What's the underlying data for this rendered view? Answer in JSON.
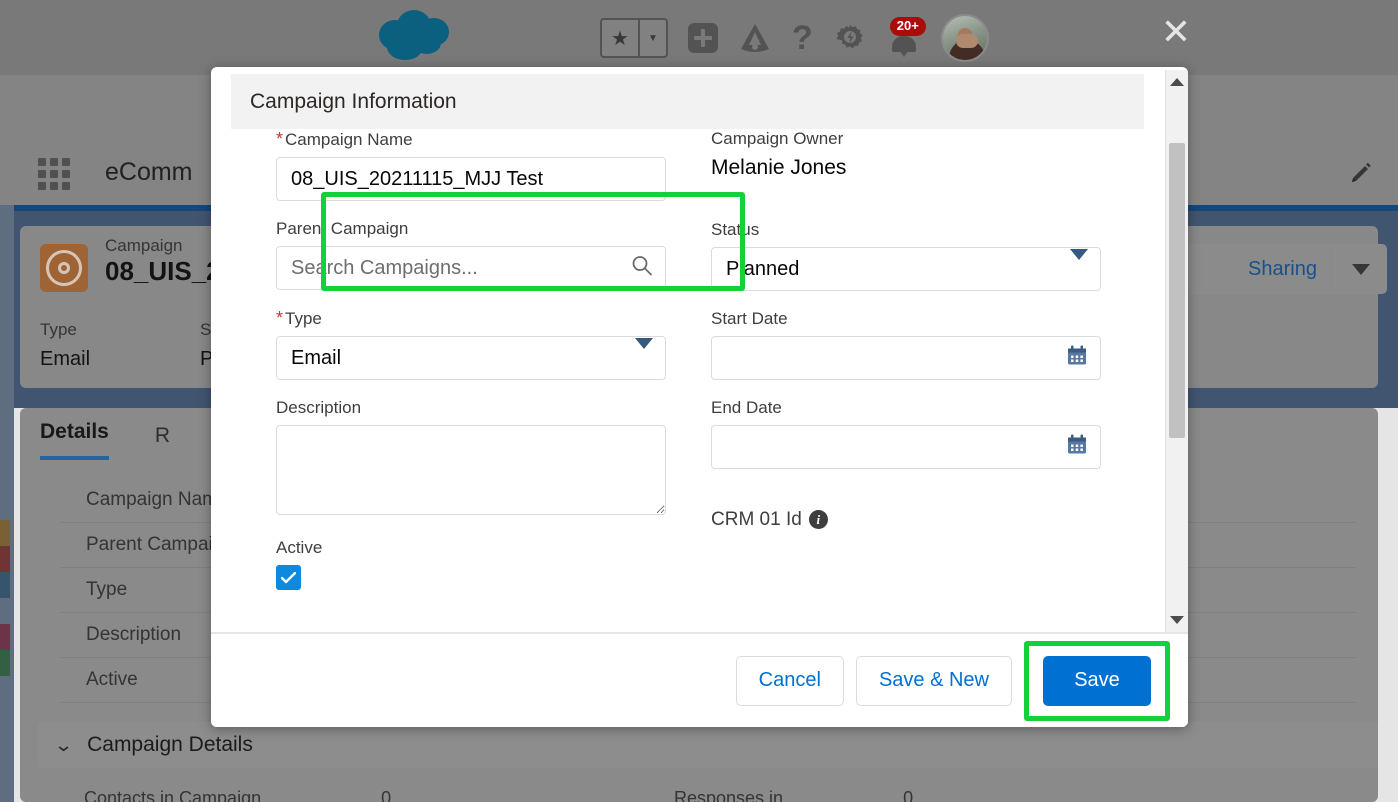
{
  "topbar": {
    "icons": [
      {
        "name": "favorites-star-icon",
        "glyph": "★"
      },
      {
        "name": "favorites-caret-icon",
        "glyph": "▼"
      },
      {
        "name": "global-actions-plus-icon",
        "glyph": "+"
      },
      {
        "name": "app-cloud-icon",
        "glyph": "◭"
      },
      {
        "name": "help-question-icon",
        "glyph": "?"
      },
      {
        "name": "setup-gear-icon",
        "glyph": "✿"
      },
      {
        "name": "notifications-bell-icon",
        "glyph": "🔔"
      }
    ],
    "help_glyph": "?",
    "notification_count": "20+",
    "close_label": "✕"
  },
  "appbar": {
    "app_name": "eComm",
    "waffle_label": "App Launcher",
    "edit_icon": "pencil-icon"
  },
  "record": {
    "kicker": "Campaign",
    "title": "08_UIS_2",
    "fields": [
      {
        "label": "Type",
        "value": "Email"
      },
      {
        "label": "S",
        "value": "P"
      }
    ],
    "sharing_label": "Sharing",
    "sharing_caret": "▼"
  },
  "tabs": [
    {
      "label": "Details",
      "active": true
    },
    {
      "label": "R",
      "active": false
    }
  ],
  "detail_rows": [
    "Campaign Nam",
    "Parent Campaig",
    "Type",
    "Description",
    "Active"
  ],
  "campaign_details_section": {
    "chevron": "⌄",
    "title": "Campaign Details",
    "left_label": "Contacts in Campaign",
    "left_value": "0",
    "right_label": "Responses in",
    "right_value": "0"
  },
  "modal": {
    "section_header": "Campaign Information",
    "left_column": {
      "campaign_name": {
        "label": "Campaign Name",
        "required": true,
        "value": "08_UIS_20211115_MJJ Test",
        "placeholder": ""
      },
      "parent_campaign": {
        "label": "Parent Campaign",
        "required": false,
        "value": "",
        "placeholder": "Search Campaigns...",
        "icon": "search-icon"
      },
      "type": {
        "label": "Type",
        "required": true,
        "value": "Email",
        "icon": "chevron-down-icon"
      },
      "description": {
        "label": "Description",
        "required": false,
        "value": "",
        "placeholder": ""
      },
      "active": {
        "label": "Active",
        "checked": true
      }
    },
    "right_column": {
      "campaign_owner": {
        "label": "Campaign Owner",
        "value": "Melanie Jones"
      },
      "status": {
        "label": "Status",
        "value": "Planned",
        "icon": "chevron-down-icon"
      },
      "start_date": {
        "label": "Start Date",
        "value": "",
        "placeholder": "",
        "icon": "calendar-icon"
      },
      "end_date": {
        "label": "End Date",
        "value": "",
        "placeholder": "",
        "icon": "calendar-icon"
      },
      "crm_id": {
        "label": "CRM 01 Id",
        "icon": "info-icon"
      }
    },
    "footer": {
      "cancel_label": "Cancel",
      "save_new_label": "Save & New",
      "save_label": "Save"
    },
    "scrollbar": {
      "up_arrow": "▲",
      "down_arrow": "▼"
    }
  },
  "colors": {
    "brand_blue": "#0070d2",
    "link_blue": "#0070d2",
    "highlight_green": "#13d13b",
    "required_red": "#c23934",
    "checkbox_blue": "#0d89e0",
    "badge_red": "#ab0b0b",
    "cloud_teal": "#0d6a8e",
    "record_icon_orange": "#b1703b",
    "band_blue": "#4a5f7d"
  }
}
